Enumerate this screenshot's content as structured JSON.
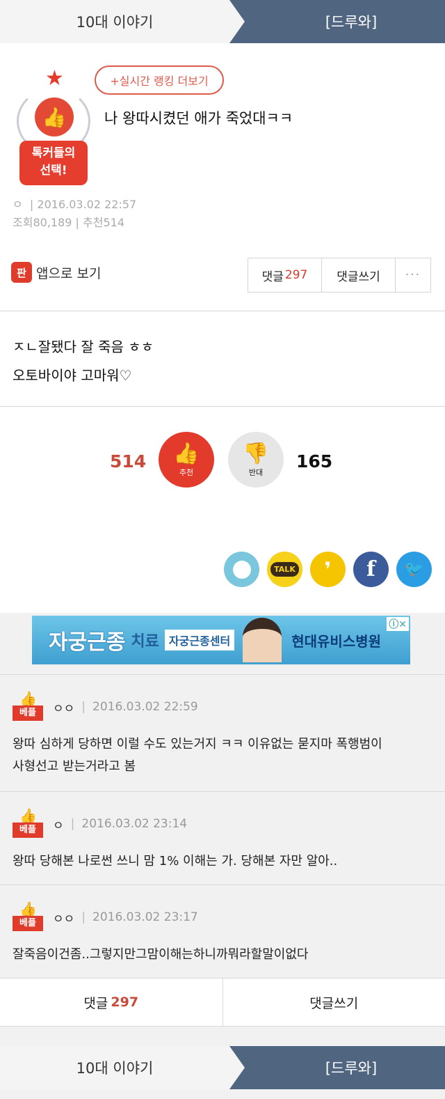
{
  "breadcrumb": {
    "category": "10대 이야기",
    "action": "[드루와]"
  },
  "post": {
    "badge_line1": "톡커들의",
    "badge_line2": "선택!",
    "ranking_button": "+실시간 랭킹 더보기",
    "title": "나 왕따시켰던 애가 죽었대ㅋㅋ",
    "author": "ㅇ",
    "date": "2016.03.02 22:57",
    "views_label": "조회",
    "views": "80,189",
    "recommend_label": "추천",
    "recommend": "514",
    "app_icon_text": "판",
    "app_view": "앱으로 보기",
    "comment_label": "댓글",
    "comment_count": "297",
    "write_comment": "댓글쓰기",
    "more": "···"
  },
  "body": {
    "line1": "ㅈㄴ잘됐다 잘 죽음 ㅎㅎ",
    "line2": "오토바이야 고마워♡"
  },
  "votes": {
    "up_count": "514",
    "up_label": "추천",
    "down_count": "165",
    "down_label": "반대"
  },
  "share": {
    "kakao_talk": "TALK",
    "story": "❜",
    "facebook": "f",
    "twitter": "🐦"
  },
  "ad": {
    "text1": "자궁근종",
    "text2": "치료",
    "text3": "자궁근종센터",
    "text4": "현대유비스병원",
    "close": "ⓘ✕"
  },
  "comments": [
    {
      "badge": "베플",
      "author": "ㅇㅇ",
      "date": "2016.03.02 22:59",
      "lines": [
        "왕따 심하게 당하면 이럴 수도 있는거지 ㅋㅋ 이유없는 묻지마 폭행범이",
        "사형선고 받는거라고 봄"
      ]
    },
    {
      "badge": "베플",
      "author": "ㅇ",
      "date": "2016.03.02 23:14",
      "lines": [
        "왕따 당해본 나로썬 쓰니 맘 1% 이해는 가. 당해본 자만 알아.."
      ]
    },
    {
      "badge": "베플",
      "author": "ㅇㅇ",
      "date": "2016.03.02 23:17",
      "lines": [
        "잘죽음이건좀..그렇지만그맘이해는하니까뭐라할말이없다"
      ]
    }
  ],
  "bottom": {
    "comment_label": "댓글",
    "comment_count": "297",
    "write_comment": "댓글쓰기"
  },
  "footer_breadcrumb": {
    "category": "10대 이야기",
    "action": "[드루와]"
  },
  "colors": {
    "accent_red": "#e23b2c",
    "nav_blue": "#506580",
    "vote_count_red": "#c84b3a"
  }
}
